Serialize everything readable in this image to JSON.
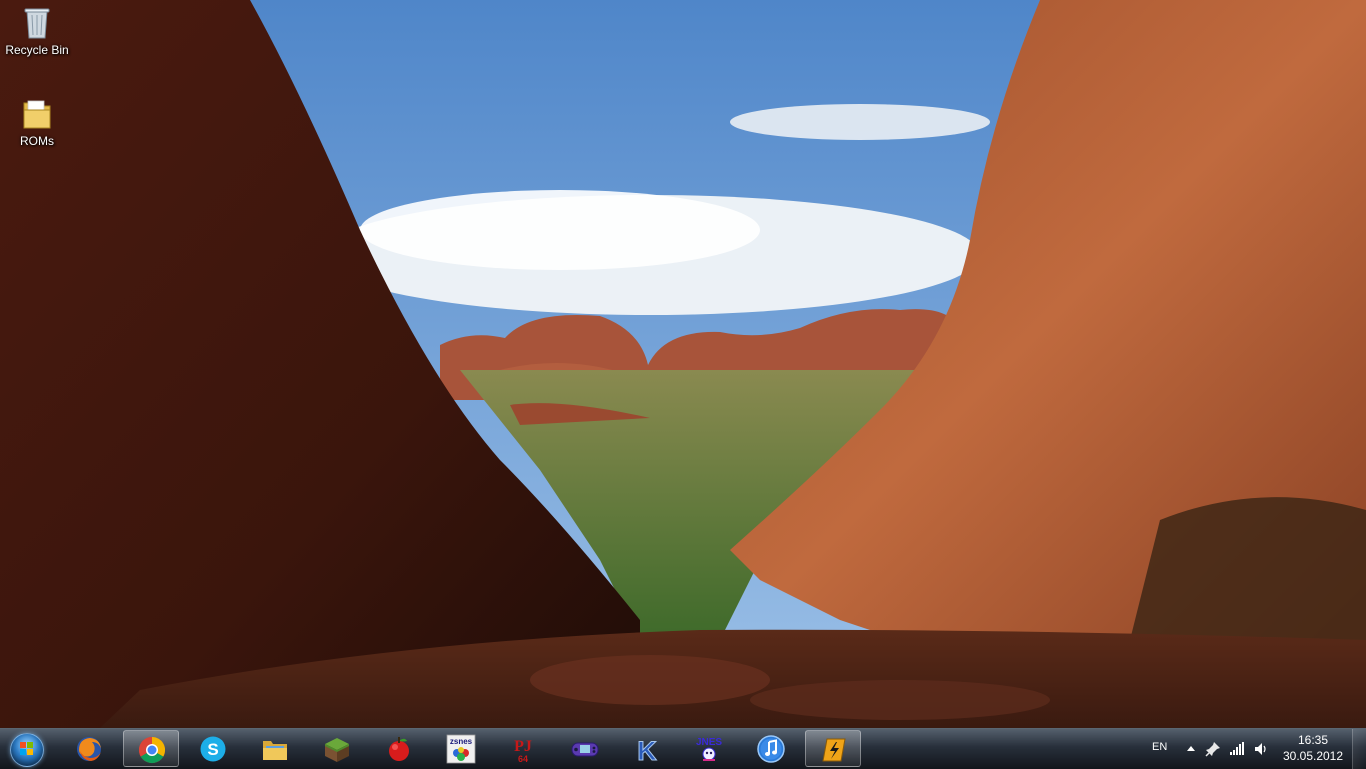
{
  "desktop": {
    "icons": [
      {
        "name": "recycle-bin",
        "label": "Recycle Bin",
        "icon": "recycle-bin-icon"
      },
      {
        "name": "roms-folder",
        "label": "ROMs",
        "icon": "folder-icon"
      }
    ]
  },
  "taskbar": {
    "pinned": [
      {
        "name": "firefox",
        "icon": "firefox-icon",
        "active": false
      },
      {
        "name": "chrome",
        "icon": "chrome-icon",
        "active": true
      },
      {
        "name": "skype",
        "icon": "skype-icon",
        "active": false
      },
      {
        "name": "explorer",
        "icon": "folder-icon",
        "active": false
      },
      {
        "name": "minecraft",
        "icon": "minecraft-icon",
        "active": false
      },
      {
        "name": "apple-emulator",
        "icon": "red-apple-icon",
        "active": false
      },
      {
        "name": "zsnes",
        "icon": "zsnes-icon",
        "active": false,
        "text": "zsnes"
      },
      {
        "name": "project64",
        "icon": "project64-icon",
        "active": false,
        "text": "PJ"
      },
      {
        "name": "gba-emulator",
        "icon": "gamepad-icon",
        "active": false
      },
      {
        "name": "kega",
        "icon": "kega-icon",
        "active": false,
        "text": "K"
      },
      {
        "name": "jnes",
        "icon": "jnes-icon",
        "active": false,
        "text": "JNES"
      },
      {
        "name": "itunes",
        "icon": "itunes-icon",
        "active": false
      },
      {
        "name": "winamp",
        "icon": "winamp-icon",
        "active": true
      }
    ],
    "tray": {
      "language": "EN",
      "time": "16:35",
      "date": "30.05.2012"
    }
  }
}
